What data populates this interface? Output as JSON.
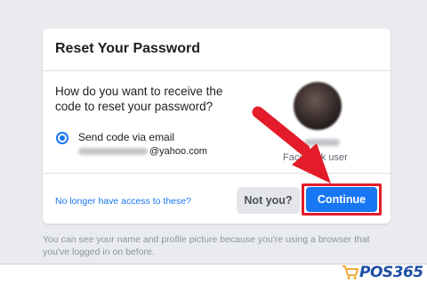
{
  "dialog": {
    "title": "Reset Your Password",
    "question": "How do you want to receive the code to reset your password?",
    "option_label": "Send code via email",
    "email_domain": "@yahoo.com",
    "user_label": "Facebook user",
    "no_access_link": "No longer have access to these?",
    "not_you_label": "Not you?",
    "continue_label": "Continue"
  },
  "footnote": "You can see your name and profile picture because you're using a browser that you've logged in on before.",
  "watermark": "POS365",
  "colors": {
    "primary": "#1877f2",
    "highlight": "#e41b2a",
    "background": "#e9ebee"
  }
}
